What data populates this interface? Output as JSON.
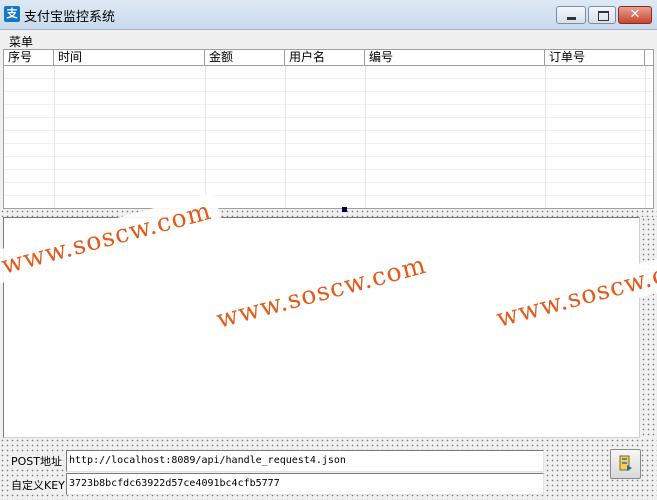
{
  "window": {
    "title": "支付宝监控系统",
    "icon": "alipay-icon",
    "close_symbol": "✕"
  },
  "menu": {
    "items": [
      "菜单"
    ]
  },
  "table": {
    "columns": [
      "序号",
      "时间",
      "金额",
      "用户名",
      "编号",
      "订单号"
    ],
    "rows": []
  },
  "form": {
    "post_label": "POST地址",
    "post_value": "http://localhost:8089/api/handle_request4.json",
    "key_label": "自定义KEY",
    "key_value": "3723b8bcfdc63922d57ce4091bc4cfb5777"
  },
  "watermark": {
    "texts": [
      "www.soscw.com",
      "www.soscw.com",
      "www.soscw.com"
    ],
    "color": "#e35a1a"
  }
}
